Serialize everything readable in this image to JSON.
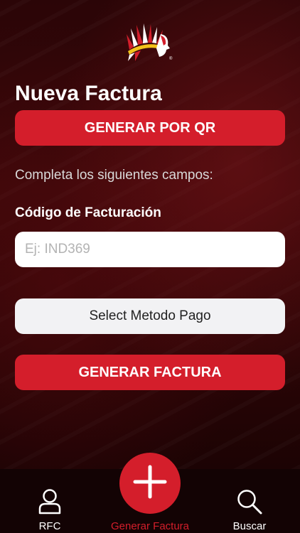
{
  "header": {
    "logo_icon": "chief-headdress-logo",
    "title": "Nueva Factura"
  },
  "actions": {
    "qr_label": "GENERAR POR QR",
    "generate_label": "GENERAR FACTURA"
  },
  "form": {
    "instructions": "Completa los siguientes campos:",
    "code_label": "Código de Facturación",
    "code_placeholder": "Ej: IND369",
    "code_value": "",
    "payment_select_label": "Select Metodo Pago"
  },
  "tabbar": {
    "items": [
      {
        "label": "RFC",
        "icon": "person-icon",
        "active": false
      },
      {
        "label": "Generar Factura",
        "icon": "plus-icon",
        "active": true
      },
      {
        "label": "Buscar",
        "icon": "search-icon",
        "active": false
      }
    ]
  },
  "colors": {
    "accent": "#d41e2b",
    "background": "#2b0507",
    "tabbar": "#130304",
    "text": "#ffffff"
  }
}
